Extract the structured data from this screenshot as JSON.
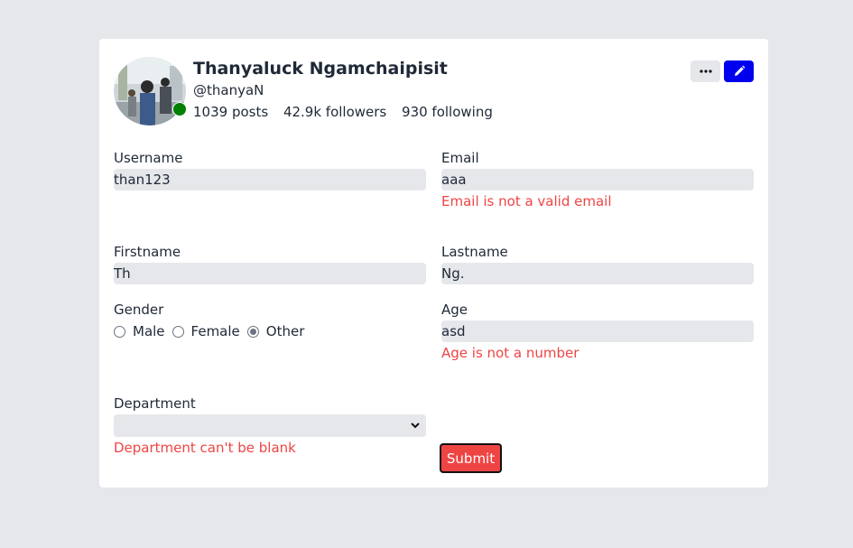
{
  "profile": {
    "name": "Thanyaluck Ngamchaipisit",
    "handle": "@thanyaN",
    "posts": "1039 posts",
    "followers": "42.9k followers",
    "following": "930 following",
    "status": "online"
  },
  "actions": {
    "more_icon": "more-icon",
    "edit_icon": "pencil-icon"
  },
  "form": {
    "username": {
      "label": "Username",
      "value": "than123"
    },
    "email": {
      "label": "Email",
      "value": "aaa",
      "error": "Email is not a valid email"
    },
    "firstname": {
      "label": "Firstname",
      "value": "Th"
    },
    "lastname": {
      "label": "Lastname",
      "value": "Ng."
    },
    "gender": {
      "label": "Gender",
      "options": [
        "Male",
        "Female",
        "Other"
      ],
      "selected": "Other"
    },
    "age": {
      "label": "Age",
      "value": "asd",
      "error": "Age is not a number"
    },
    "department": {
      "label": "Department",
      "value": "",
      "error": "Department can't be blank"
    },
    "submit_label": "Submit"
  },
  "colors": {
    "page_bg": "#e5e7eb",
    "card_bg": "#ffffff",
    "error": "#ef4444",
    "status_online": "#008000",
    "edit_button": "#0000ee",
    "submit_bg": "#ef4444"
  }
}
